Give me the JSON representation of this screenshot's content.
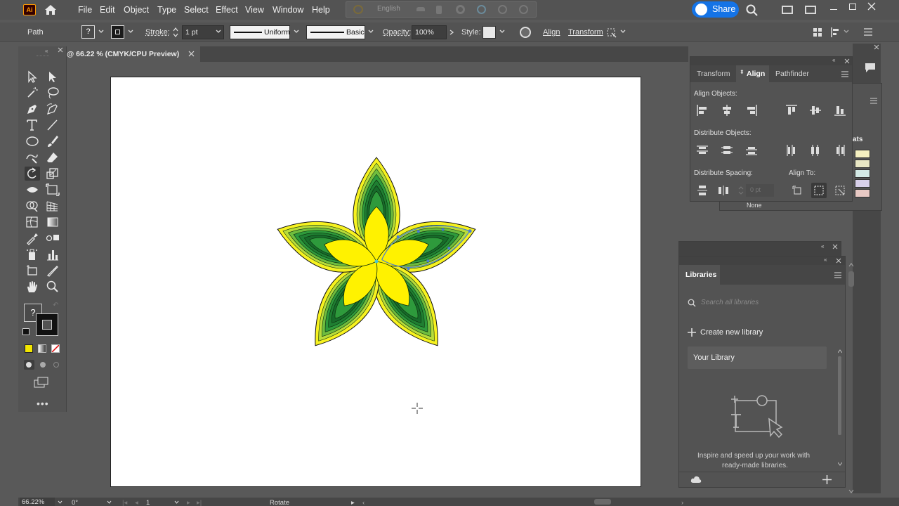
{
  "app": {
    "logo_text": "Ai",
    "menu": [
      "File",
      "Edit",
      "Object",
      "Type",
      "Select",
      "Effect",
      "View",
      "Window",
      "Help"
    ],
    "search_hint_text": "English",
    "share_label": "Share"
  },
  "control_bar": {
    "selection_type": "Path",
    "stroke_label": "Stroke:",
    "stroke_weight": "1 pt",
    "stroke_profile": "Uniform",
    "brush": "Basic",
    "opacity_label": "Opacity:",
    "opacity_value": "100%",
    "style_label": "Style:",
    "align_link": "Align",
    "transform_link": "Transform"
  },
  "document": {
    "tab_title": "@ 66.22 % (CMYK/CPU Preview)"
  },
  "align_panel": {
    "tabs": [
      "Transform",
      "Align",
      "Pathfinder"
    ],
    "align_objects_label": "Align Objects:",
    "distribute_objects_label": "Distribute Objects:",
    "distribute_spacing_label": "Distribute Spacing:",
    "align_to_label": "Align To:",
    "spacing_value": "0 pt"
  },
  "behind_panel": {
    "partial_label": "ats",
    "none_label": "None"
  },
  "libraries_panel": {
    "title": "Libraries",
    "search_placeholder": "Search all libraries",
    "create_label": "Create new library",
    "library_item": "Your Library",
    "empty_message_line1": "Inspire and speed up your work with",
    "empty_message_line2": "ready-made libraries."
  },
  "status_bar": {
    "zoom": "66.22%",
    "rotation": "0°",
    "artboard_number": "1",
    "tool_name": "Rotate"
  },
  "colors": {
    "petal_outer": "#f7f220",
    "petal_mid_light": "#9bd04a",
    "petal_mid": "#2e9a3c",
    "petal_dark": "#176b2a",
    "petal_inner": "#fff200",
    "selection_blue": "#4a7fd4",
    "accent_share": "#1473e6"
  },
  "swatches": [
    "#f5f0c0",
    "#e9e7c4",
    "#d3e9e5",
    "#d8d0ea",
    "#e8c9c4"
  ]
}
